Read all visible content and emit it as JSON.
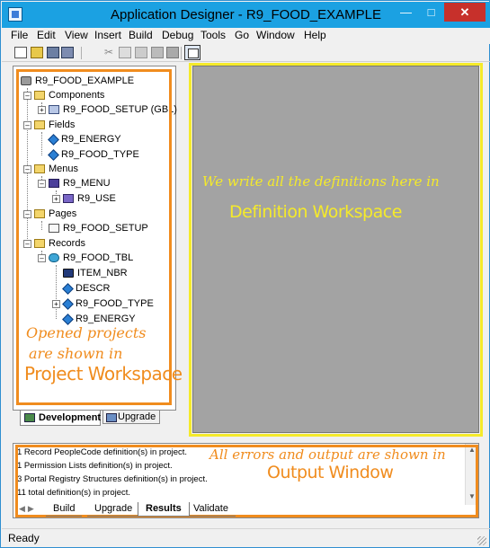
{
  "window": {
    "title": "Application Designer - R9_FOOD_EXAMPLE",
    "minimize": "—",
    "maximize": "□",
    "close": "✕"
  },
  "menu": [
    "File",
    "Edit",
    "View",
    "Insert",
    "Build",
    "Debug",
    "Tools",
    "Go",
    "Window",
    "Help"
  ],
  "toolbar_icons": [
    "new-icon",
    "open-icon",
    "save-icon",
    "save-all-icon",
    "cut-icon",
    "copy-icon",
    "paste-icon",
    "find-definition-references-icon",
    "build-icon",
    "project-workspace-icon"
  ],
  "project_tree": {
    "root": "R9_FOOD_EXAMPLE",
    "components_folder": "Components",
    "component": "R9_FOOD_SETUP (GBL)",
    "fields_folder": "Fields",
    "field_1": "R9_ENERGY",
    "field_2": "R9_FOOD_TYPE",
    "menus_folder": "Menus",
    "menu": "R9_MENU",
    "menu_item": "R9_USE",
    "pages_folder": "Pages",
    "page": "R9_FOOD_SETUP",
    "records_folder": "Records",
    "record": "R9_FOOD_TBL",
    "rec_field_1": "ITEM_NBR",
    "rec_field_2": "DESCR",
    "rec_field_3": "R9_FOOD_TYPE",
    "rec_field_4": "R9_ENERGY"
  },
  "workspace_tabs": {
    "development": "Development",
    "upgrade": "Upgrade"
  },
  "annotations": {
    "project_line1": "Opened projects",
    "project_line2": "are shown in",
    "project_line3": "Project Workspace",
    "definition_line1": "We write all the definitions here in",
    "definition_line2": "Definition Workspace",
    "output_line1": "All errors and output are shown in",
    "output_line2": "Output Window",
    "orange_color": "#f08c1e",
    "yellow_color": "#f5ea2a"
  },
  "output": {
    "lines": [
      "1 Record PeopleCode  definition(s) in project.",
      "1 Permission Lists  definition(s) in project.",
      "3 Portal Registry Structures  definition(s) in project.",
      "11  total definition(s) in project."
    ],
    "tabs": [
      "Build",
      "Upgrade",
      "Results",
      "Validate"
    ],
    "active_tab": "Results"
  },
  "status": {
    "text": "Ready"
  }
}
